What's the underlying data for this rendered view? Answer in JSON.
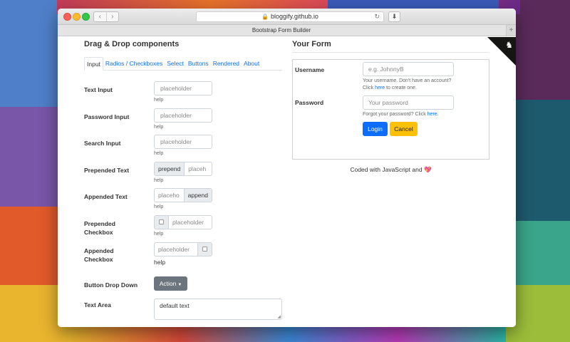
{
  "browser": {
    "url": "bloggify.github.io",
    "tab_title": "Bootstrap Form Builder",
    "back_icon": "‹",
    "forward_icon": "›",
    "reload_icon": "↻",
    "download_icon": "⬇",
    "lock_icon": "🔒",
    "new_tab_icon": "+"
  },
  "left": {
    "title": "Drag & Drop components",
    "tabs": [
      "Input",
      "Radios / Checkboxes",
      "Select",
      "Buttons",
      "Rendered",
      "About"
    ],
    "components": {
      "text_input": {
        "label": "Text Input",
        "placeholder": "placeholder",
        "help": "help"
      },
      "password_input": {
        "label": "Password Input",
        "placeholder": "placeholder",
        "help": "help"
      },
      "search_input": {
        "label": "Search Input",
        "placeholder": "placeholder",
        "help": "help"
      },
      "prepended_text": {
        "label": "Prepended Text",
        "addon": "prepend",
        "placeholder": "placeh",
        "help": "help"
      },
      "appended_text": {
        "label": "Appended Text",
        "addon": "append",
        "placeholder": "placeho",
        "help": "help"
      },
      "prepended_checkbox": {
        "label": "Prepended Checkbox",
        "placeholder": "placeholder",
        "help": "help"
      },
      "appended_checkbox": {
        "label": "Appended Checkbox",
        "placeholder": "placeholder",
        "help": "help"
      },
      "button_dropdown": {
        "label": "Button Drop Down",
        "button": "Action"
      },
      "text_area": {
        "label": "Text Area",
        "value": "default text"
      }
    }
  },
  "right": {
    "title": "Your Form",
    "username": {
      "label": "Username",
      "placeholder": "e.g. JohnnyB",
      "help_line1": "Your username. Don't have an account?",
      "help_pre": "Click ",
      "help_link": "here",
      "help_post": " to create one."
    },
    "password": {
      "label": "Password",
      "placeholder": "Your password",
      "help_pre": "Forgot your password? Click ",
      "help_link": "here."
    },
    "login_button": "Login",
    "cancel_button": "Cancel",
    "footer_text": "Coded with JavaScript and",
    "heart_icon": "💖"
  },
  "colors": {
    "primary": "#0d6efd",
    "warning": "#ffc107",
    "secondary": "#6c757d"
  }
}
